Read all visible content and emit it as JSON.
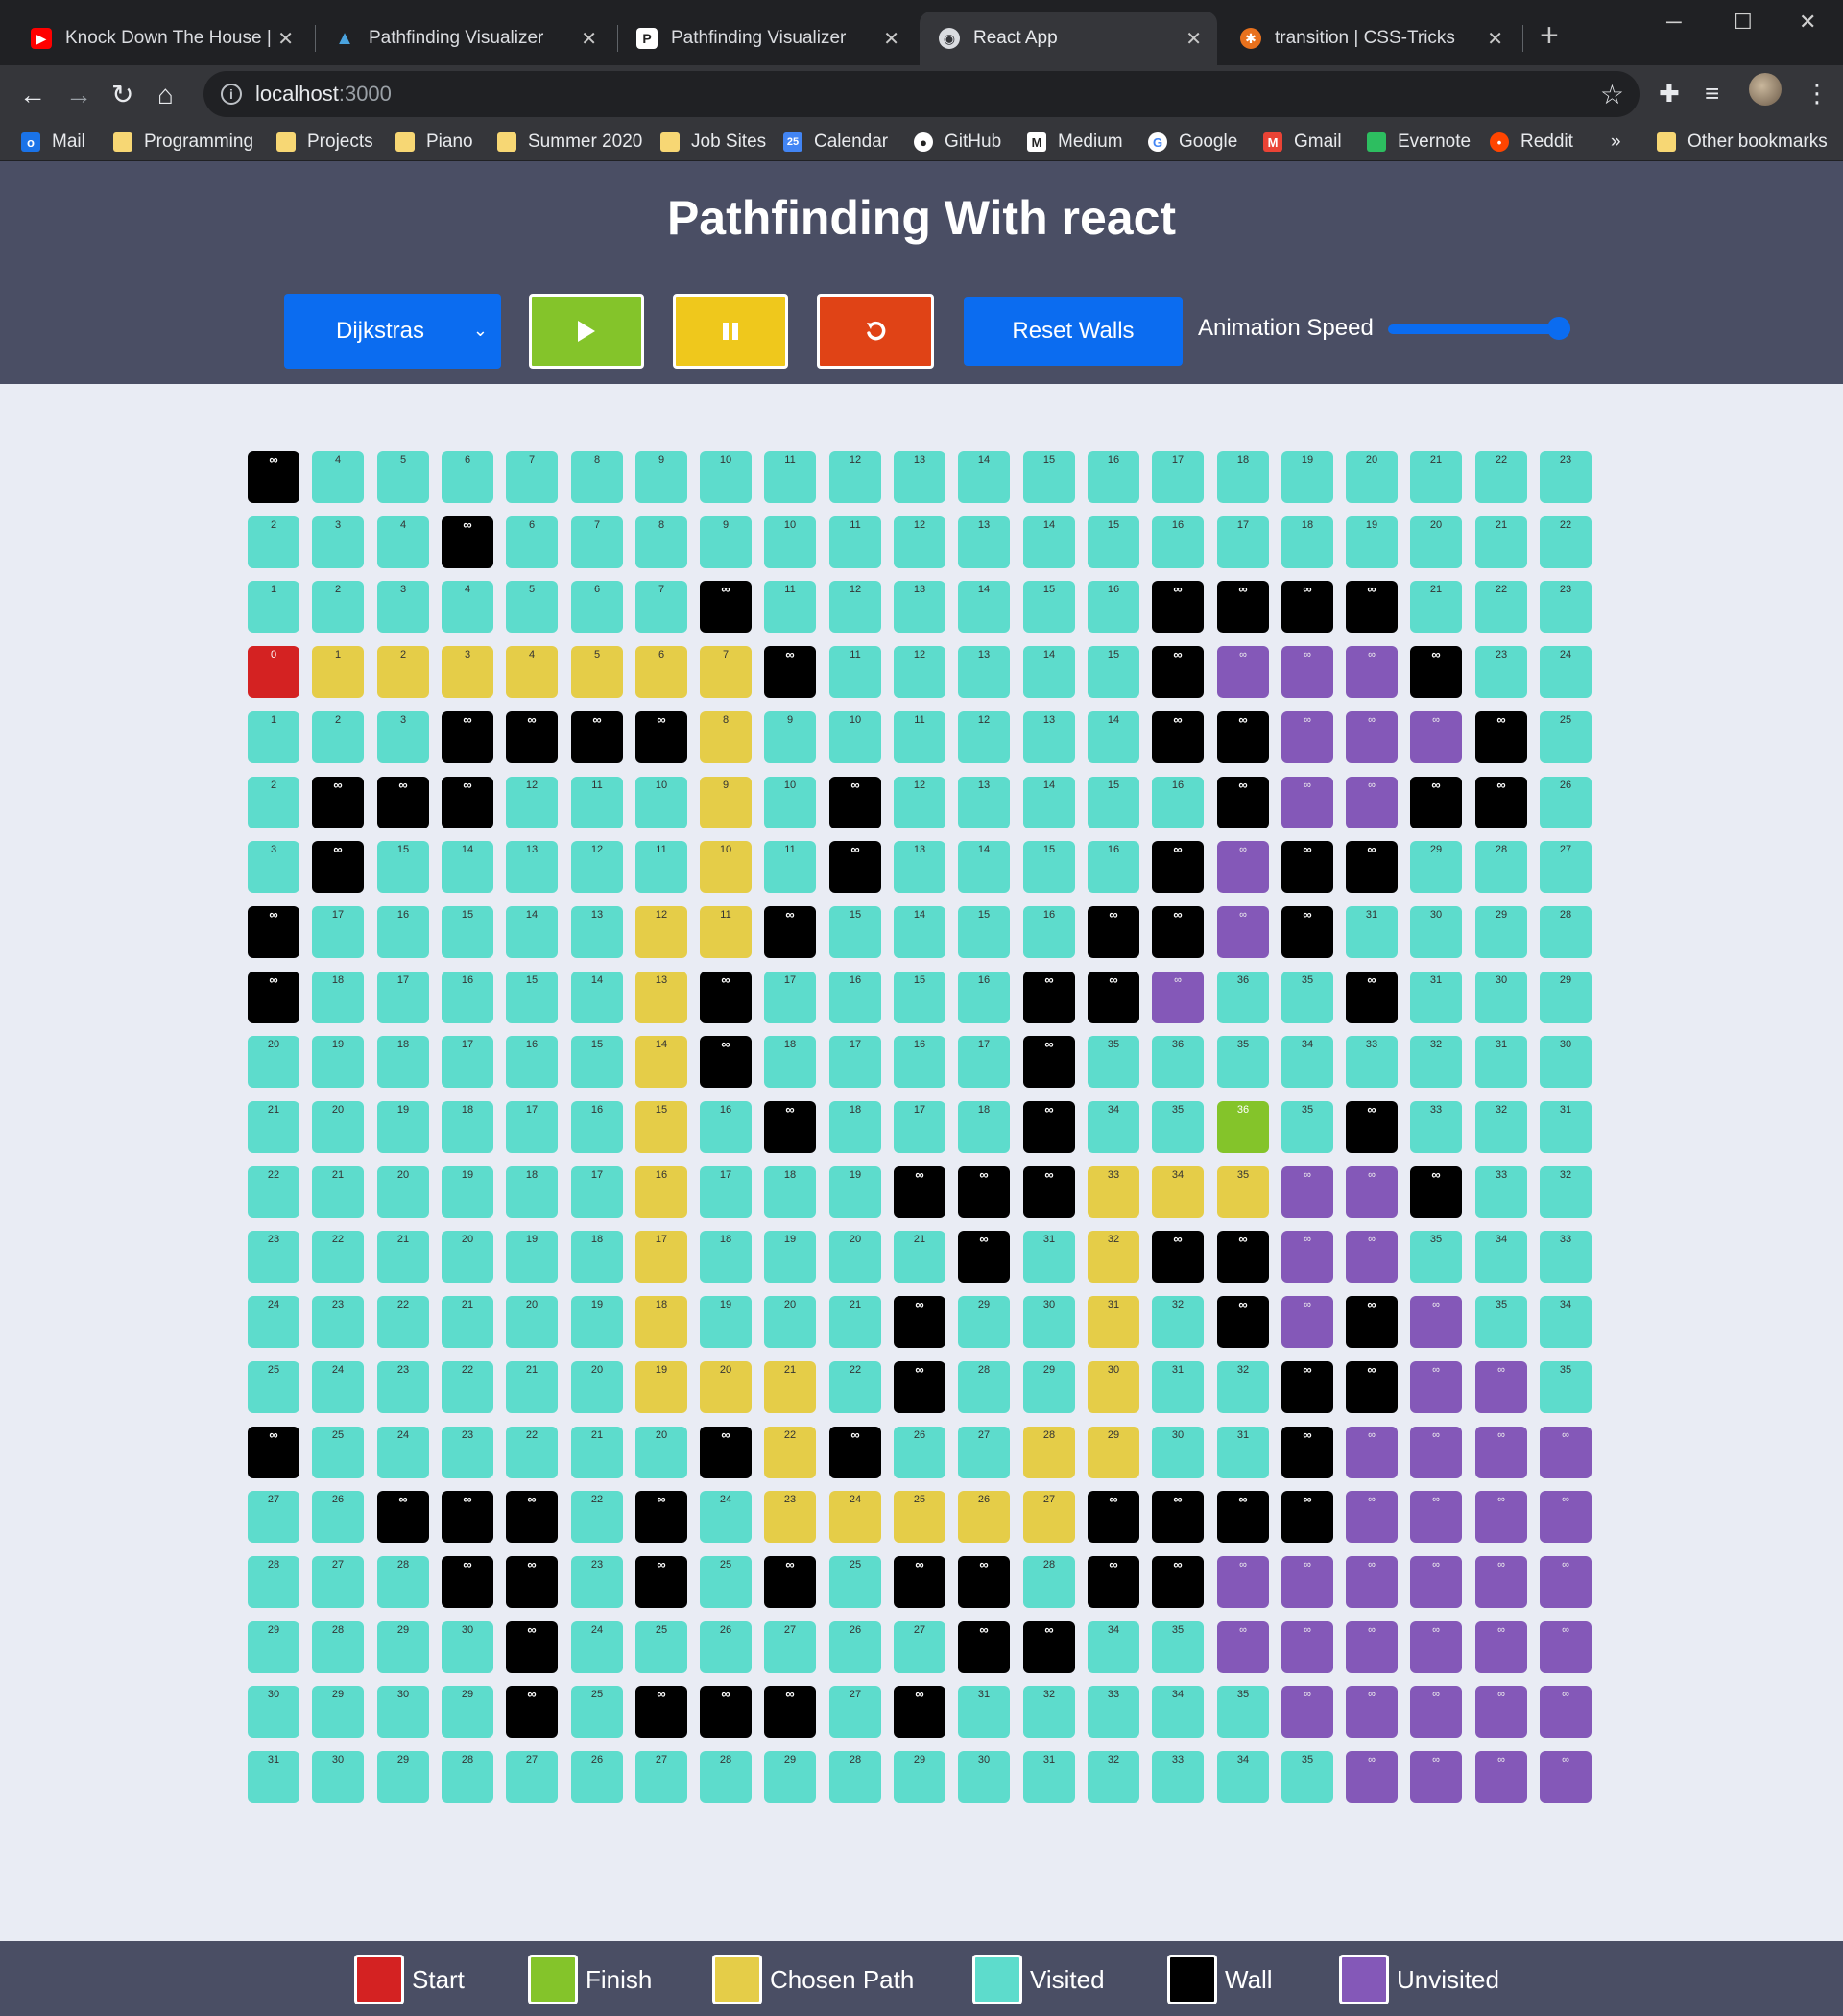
{
  "browser": {
    "tabs": [
      {
        "title": "Knock Down The House | Fl",
        "icon": "youtube-icon",
        "color": "#ff0000",
        "active": false
      },
      {
        "title": "Pathfinding Visualizer",
        "icon": "app-icon",
        "color": "#4aa3df",
        "active": false
      },
      {
        "title": "Pathfinding Visualizer",
        "icon": "p-icon",
        "color": "#ffffff",
        "active": false
      },
      {
        "title": "React App",
        "icon": "globe-icon",
        "color": "#dadce0",
        "active": true
      },
      {
        "title": "transition | CSS-Tricks",
        "icon": "css-tricks-icon",
        "color": "#e8711d",
        "active": false
      }
    ],
    "url_host": "localhost",
    "url_port": ":3000",
    "bookmarks": [
      {
        "label": "Mail",
        "icon": "outlook-icon",
        "color": "#1a73e8"
      },
      {
        "label": "Programming",
        "icon": "folder-icon",
        "color": "#f7d774"
      },
      {
        "label": "Projects",
        "icon": "folder-icon",
        "color": "#f7d774"
      },
      {
        "label": "Piano",
        "icon": "folder-icon",
        "color": "#f7d774"
      },
      {
        "label": "Summer 2020",
        "icon": "folder-icon",
        "color": "#f7d774"
      },
      {
        "label": "Job Sites",
        "icon": "folder-icon",
        "color": "#f7d774"
      },
      {
        "label": "Calendar",
        "icon": "calendar-icon",
        "color": "#4285f4"
      },
      {
        "label": "GitHub",
        "icon": "github-icon",
        "color": "#ffffff"
      },
      {
        "label": "Medium",
        "icon": "medium-icon",
        "color": "#ffffff"
      },
      {
        "label": "Google",
        "icon": "google-icon",
        "color": "#ffffff"
      },
      {
        "label": "Gmail",
        "icon": "gmail-icon",
        "color": "#ea4335"
      },
      {
        "label": "Evernote",
        "icon": "evernote-icon",
        "color": "#2dbe60"
      },
      {
        "label": "Reddit",
        "icon": "reddit-icon",
        "color": "#ff4500"
      }
    ],
    "other_bookmarks": "Other bookmarks",
    "more_glyph": "»"
  },
  "app": {
    "title": "Pathfinding With react",
    "algorithm": "Dijkstras",
    "reset_walls": "Reset Walls",
    "speed_label": "Animation Speed",
    "speed_level": 1.0
  },
  "grid": {
    "rows": [
      [
        "W",
        "V4",
        "V5",
        "V6",
        "V7",
        "V8",
        "V9",
        "V10",
        "V11",
        "V12",
        "V13",
        "V14",
        "V15",
        "V16",
        "V17",
        "V18",
        "V19",
        "V20",
        "V21",
        "V22",
        "V23"
      ],
      [
        "V2",
        "V3",
        "V4",
        "W",
        "V6",
        "V7",
        "V8",
        "V9",
        "V10",
        "V11",
        "V12",
        "V13",
        "V14",
        "V15",
        "V16",
        "V17",
        "V18",
        "V19",
        "V20",
        "V21",
        "V22"
      ],
      [
        "V1",
        "V2",
        "V3",
        "V4",
        "V5",
        "V6",
        "V7",
        "W",
        "V11",
        "V12",
        "V13",
        "V14",
        "V15",
        "V16",
        "W",
        "W",
        "W",
        "W",
        "V21",
        "V22",
        "V23"
      ],
      [
        "S0",
        "P1",
        "P2",
        "P3",
        "P4",
        "P5",
        "P6",
        "P7",
        "W",
        "V11",
        "V12",
        "V13",
        "V14",
        "V15",
        "W",
        "U",
        "U",
        "U",
        "W",
        "V23",
        "V24"
      ],
      [
        "V1",
        "V2",
        "V3",
        "W",
        "W",
        "W",
        "W",
        "P8",
        "V9",
        "V10",
        "V11",
        "V12",
        "V13",
        "V14",
        "W",
        "W",
        "U",
        "U",
        "U",
        "W",
        "V25"
      ],
      [
        "V2",
        "W",
        "W",
        "W",
        "V12",
        "V11",
        "V10",
        "P9",
        "V10",
        "W",
        "V12",
        "V13",
        "V14",
        "V15",
        "V16",
        "W",
        "U",
        "U",
        "W",
        "W",
        "V26"
      ],
      [
        "V3",
        "W",
        "V15",
        "V14",
        "V13",
        "V12",
        "V11",
        "P10",
        "V11",
        "W",
        "V13",
        "V14",
        "V15",
        "V16",
        "W",
        "U",
        "W",
        "W",
        "V29",
        "V28",
        "V27"
      ],
      [
        "W",
        "V17",
        "V16",
        "V15",
        "V14",
        "V13",
        "P12",
        "P11",
        "W",
        "V15",
        "V14",
        "V15",
        "V16",
        "W",
        "W",
        "U",
        "W",
        "V31",
        "V30",
        "V29",
        "V28"
      ],
      [
        "W",
        "V18",
        "V17",
        "V16",
        "V15",
        "V14",
        "P13",
        "W",
        "V17",
        "V16",
        "V15",
        "V16",
        "W",
        "W",
        "U",
        "V36",
        "V35",
        "W",
        "V31",
        "V30",
        "V29"
      ],
      [
        "V20",
        "V19",
        "V18",
        "V17",
        "V16",
        "V15",
        "P14",
        "W",
        "V18",
        "V17",
        "V16",
        "V17",
        "W",
        "V35",
        "V36",
        "V35",
        "V34",
        "V33",
        "V32",
        "V31",
        "V30"
      ],
      [
        "V21",
        "V20",
        "V19",
        "V18",
        "V17",
        "V16",
        "P15",
        "V16",
        "W",
        "V18",
        "V17",
        "V18",
        "W",
        "V34",
        "V35",
        "F36",
        "V35",
        "W",
        "V33",
        "V32",
        "V31"
      ],
      [
        "V22",
        "V21",
        "V20",
        "V19",
        "V18",
        "V17",
        "P16",
        "V17",
        "V18",
        "V19",
        "W",
        "W",
        "W",
        "P33",
        "P34",
        "P35",
        "U",
        "U",
        "W",
        "V33",
        "V32"
      ],
      [
        "V23",
        "V22",
        "V21",
        "V20",
        "V19",
        "V18",
        "P17",
        "V18",
        "V19",
        "V20",
        "V21",
        "W",
        "V31",
        "P32",
        "W",
        "W",
        "U",
        "U",
        "V35",
        "V34",
        "V33"
      ],
      [
        "V24",
        "V23",
        "V22",
        "V21",
        "V20",
        "V19",
        "P18",
        "V19",
        "V20",
        "V21",
        "W",
        "V29",
        "V30",
        "P31",
        "V32",
        "W",
        "U",
        "W",
        "U",
        "V35",
        "V34"
      ],
      [
        "V25",
        "V24",
        "V23",
        "V22",
        "V21",
        "V20",
        "P19",
        "P20",
        "P21",
        "V22",
        "W",
        "V28",
        "V29",
        "P30",
        "V31",
        "V32",
        "W",
        "W",
        "U",
        "U",
        "V35"
      ],
      [
        "W",
        "V25",
        "V24",
        "V23",
        "V22",
        "V21",
        "V20",
        "W",
        "P22",
        "W",
        "V26",
        "V27",
        "P28",
        "P29",
        "V30",
        "V31",
        "W",
        "U",
        "U",
        "U",
        "U"
      ],
      [
        "V27",
        "V26",
        "W",
        "W",
        "W",
        "V22",
        "W",
        "V24",
        "P23",
        "P24",
        "P25",
        "P26",
        "P27",
        "W",
        "W",
        "W",
        "W",
        "U",
        "U",
        "U",
        "U"
      ],
      [
        "V28",
        "V27",
        "V28",
        "W",
        "W",
        "V23",
        "W",
        "V25",
        "W",
        "V25",
        "W",
        "W",
        "V28",
        "W",
        "W",
        "U",
        "U",
        "U",
        "U",
        "U",
        "U"
      ],
      [
        "V29",
        "V28",
        "V29",
        "V30",
        "W",
        "V24",
        "V25",
        "V26",
        "V27",
        "V26",
        "V27",
        "W",
        "W",
        "V34",
        "V35",
        "U",
        "U",
        "U",
        "U",
        "U",
        "U"
      ],
      [
        "V30",
        "V29",
        "V30",
        "V29",
        "W",
        "V25",
        "W",
        "W",
        "W",
        "V27",
        "W",
        "V31",
        "V32",
        "V33",
        "V34",
        "V35",
        "U",
        "U",
        "U",
        "U",
        "U"
      ],
      [
        "V31",
        "V30",
        "V29",
        "V28",
        "V27",
        "V26",
        "V27",
        "V28",
        "V29",
        "V28",
        "V29",
        "V30",
        "V31",
        "V32",
        "V33",
        "V34",
        "V35",
        "U",
        "U",
        "U",
        "U"
      ]
    ],
    "infinity_label": "∞"
  },
  "legend": [
    {
      "label": "Start",
      "color": "#d42222"
    },
    {
      "label": "Finish",
      "color": "#84c42a"
    },
    {
      "label": "Chosen Path",
      "color": "#e5cd48"
    },
    {
      "label": "Visited",
      "color": "#5ddccc"
    },
    {
      "label": "Wall",
      "color": "#000000"
    },
    {
      "label": "Unvisited",
      "color": "#8458b8"
    }
  ]
}
